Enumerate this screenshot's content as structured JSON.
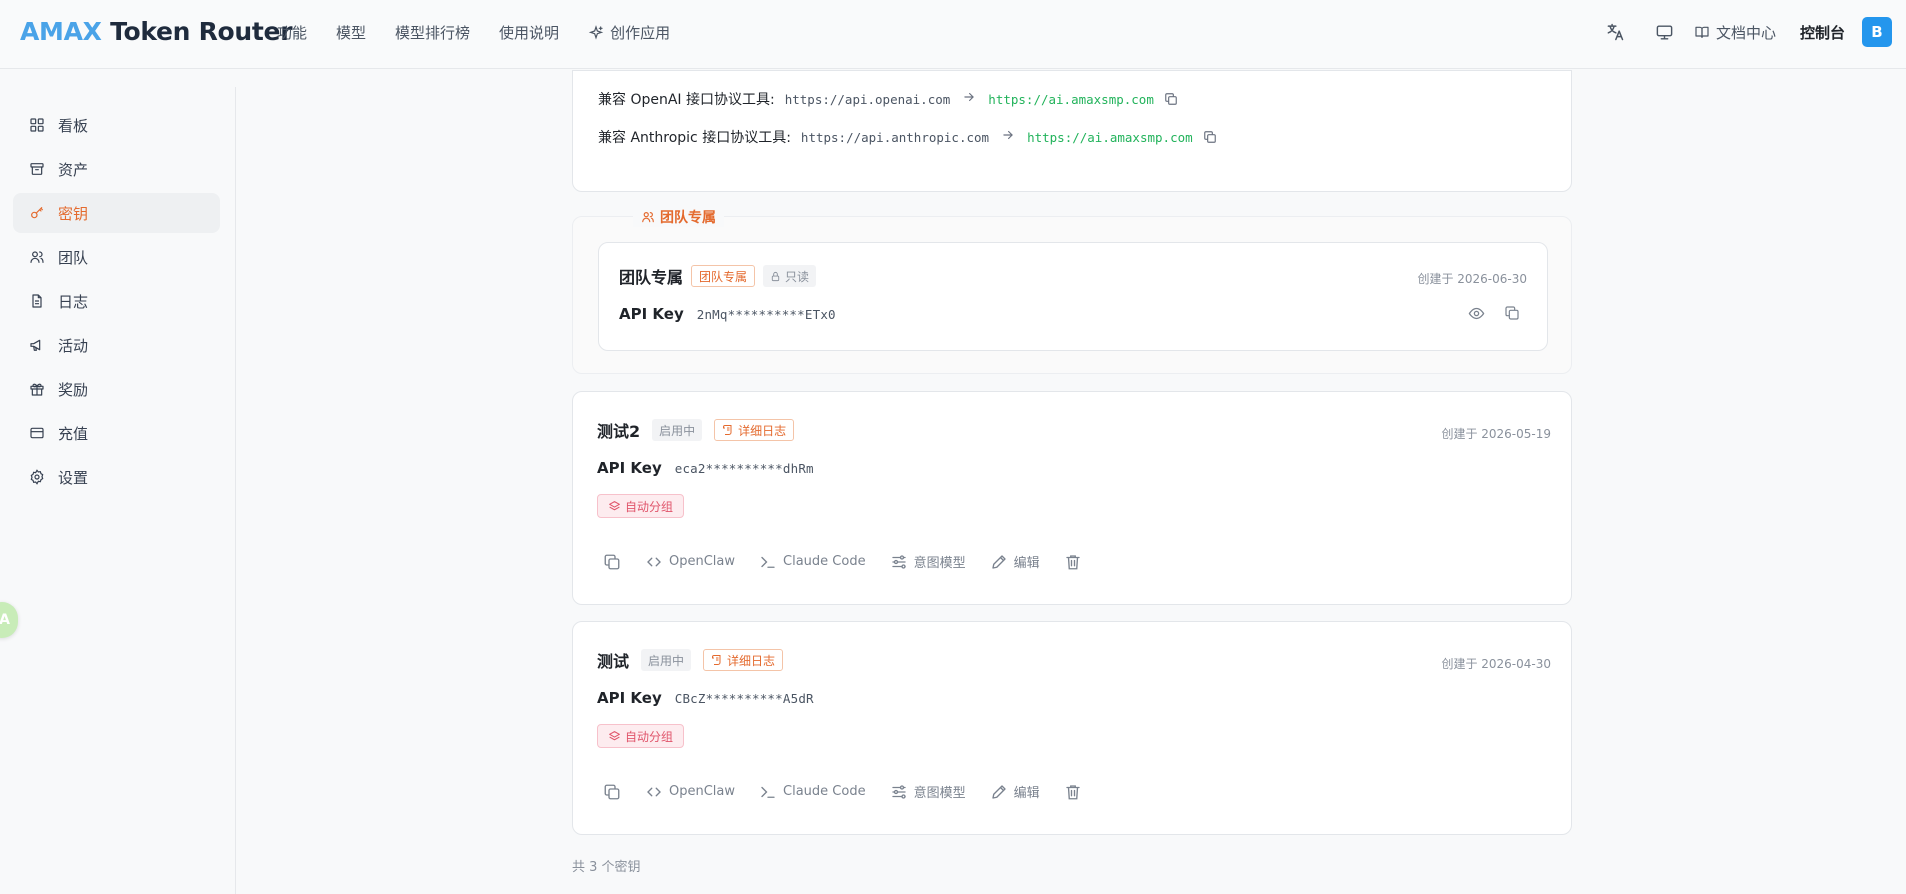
{
  "header": {
    "logo_brand": "AMAX",
    "logo_rest": "Token Router",
    "nav": [
      {
        "label": "功能"
      },
      {
        "label": "模型"
      },
      {
        "label": "模型排行榜"
      },
      {
        "label": "使用说明"
      },
      {
        "label": "创作应用",
        "icon": "sparkle-icon"
      }
    ],
    "docs_label": "文档中心",
    "console_label": "控制台",
    "avatar_letter": "B"
  },
  "sidebar": {
    "items": [
      {
        "label": "看板",
        "icon": "dashboard-icon"
      },
      {
        "label": "资产",
        "icon": "archive-icon"
      },
      {
        "label": "密钥",
        "icon": "key-icon",
        "active": true
      },
      {
        "label": "团队",
        "icon": "users-icon"
      },
      {
        "label": "日志",
        "icon": "file-icon"
      },
      {
        "label": "活动",
        "icon": "megaphone-icon"
      },
      {
        "label": "奖励",
        "icon": "gift-icon"
      },
      {
        "label": "充值",
        "icon": "credit-card-icon"
      },
      {
        "label": "设置",
        "icon": "settings-icon"
      }
    ]
  },
  "floating_badge": "A",
  "compat": {
    "rows": [
      {
        "label": "兼容 OpenAI 接口协议工具:",
        "from": "https://api.openai.com",
        "to": "https://ai.amaxsmp.com"
      },
      {
        "label": "兼容 Anthropic 接口协议工具:",
        "from": "https://api.anthropic.com",
        "to": "https://ai.amaxsmp.com"
      }
    ]
  },
  "team_section": {
    "legend": "团队专属",
    "card": {
      "title": "团队专属",
      "tag_team": "团队专属",
      "tag_readonly": "只读",
      "created": "创建于 2026-06-30",
      "api_key_label": "API Key",
      "api_key": "2nMq**********ETx0"
    }
  },
  "keys": [
    {
      "name": "测试2",
      "status": "启用中",
      "log_tag": "详细日志",
      "created": "创建于 2026-05-19",
      "api_key_label": "API Key",
      "api_key": "eca2**********dhRm",
      "group": "自动分组"
    },
    {
      "name": "测试",
      "status": "启用中",
      "log_tag": "详细日志",
      "created": "创建于 2026-04-30",
      "api_key_label": "API Key",
      "api_key": "CBcZ**********A5dR",
      "group": "自动分组"
    }
  ],
  "actions": {
    "openclaw": "OpenClaw",
    "claude_code": "Claude Code",
    "intent_model": "意图模型",
    "edit": "编辑"
  },
  "footer": {
    "count_text": "共 3 个密钥"
  },
  "colors": {
    "accent": "#e46a2e",
    "brand_blue": "#4aa3e8",
    "link_green": "#22b35b",
    "group_red": "#e0556b"
  }
}
